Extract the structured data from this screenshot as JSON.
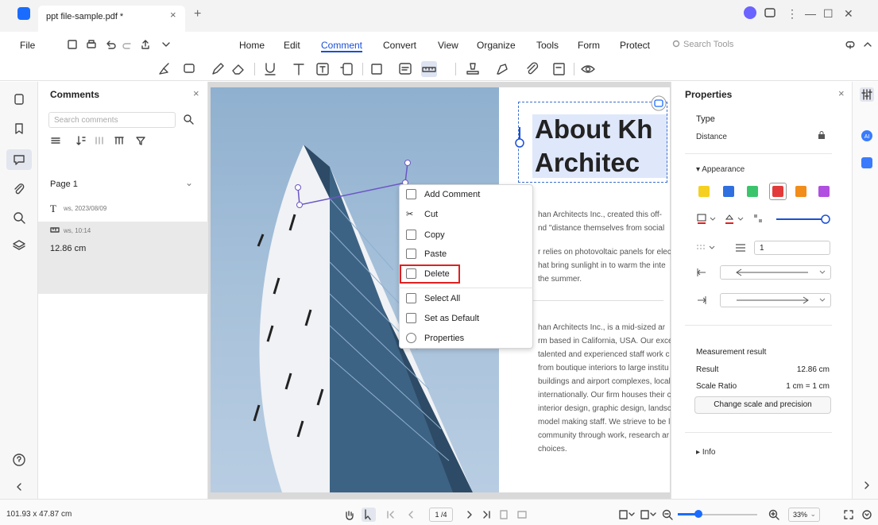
{
  "tab": {
    "title": "ppt file-sample.pdf *",
    "close": "×",
    "add": "+"
  },
  "menu": {
    "file": "File",
    "items": [
      "Home",
      "Edit",
      "Comment",
      "Convert",
      "View",
      "Organize",
      "Tools",
      "Form",
      "Protect"
    ],
    "active": "Comment",
    "search_tools": "Search Tools"
  },
  "comments_panel": {
    "title": "Comments",
    "close": "×",
    "search_placeholder": "Search comments",
    "page_label": "Page 1",
    "items": [
      {
        "icon": "T",
        "meta": "ws, 2023/08/09"
      },
      {
        "icon": "ruler-icon",
        "meta": "ws, 10:14",
        "text": "12.86 cm"
      }
    ]
  },
  "document": {
    "headline_line1": "About Kh",
    "headline_line2": "Architec",
    "para1": [
      "han Architects Inc., created this off-",
      "nd \"distance themselves from social",
      "",
      "r relies on photovoltaic panels for elec",
      "hat bring sunlight in to warm the inte",
      "the summer."
    ],
    "para2": [
      "han Architects Inc., is a mid-sized ar",
      "rm based in California, USA. Our exce",
      "talented and experienced staff work c",
      "from boutique interiors to large institu",
      "buildings and airport complexes, local",
      "internationally. Our firm houses their c",
      "interior design, graphic design, landsc",
      "model making staff. We strieve to be l",
      "community through work, research ar",
      "choices."
    ]
  },
  "context_menu": {
    "items": [
      "Add Comment",
      "Cut",
      "Copy",
      "Paste",
      "Delete",
      "Select All",
      "Set as Default",
      "Properties"
    ],
    "highlighted": "Delete"
  },
  "properties": {
    "title": "Properties",
    "close": "×",
    "type_label": "Type",
    "type_value": "Distance",
    "appearance_label": "Appearance",
    "swatches": [
      "#f5d020",
      "#2f6fe0",
      "#3cc46c",
      "#e23a3a",
      "#f28c1a",
      "#b04fe0"
    ],
    "selected_swatch": "#e23a3a",
    "thickness": "1",
    "measurement_title": "Measurement result",
    "result_label": "Result",
    "result_value": "12.86 cm",
    "scale_label": "Scale Ratio",
    "scale_value": "1 cm = 1 cm",
    "change_button": "Change scale and precision",
    "info_label": "Info"
  },
  "status": {
    "dimensions": "101.93 x 47.87 cm",
    "page": "1 /4",
    "zoom": "33%",
    "zoom_fraction": 0.26
  },
  "colors": {
    "accent": "#1a6cff",
    "highlight_red": "#e02020",
    "photo_sky": "#a7c1da"
  }
}
